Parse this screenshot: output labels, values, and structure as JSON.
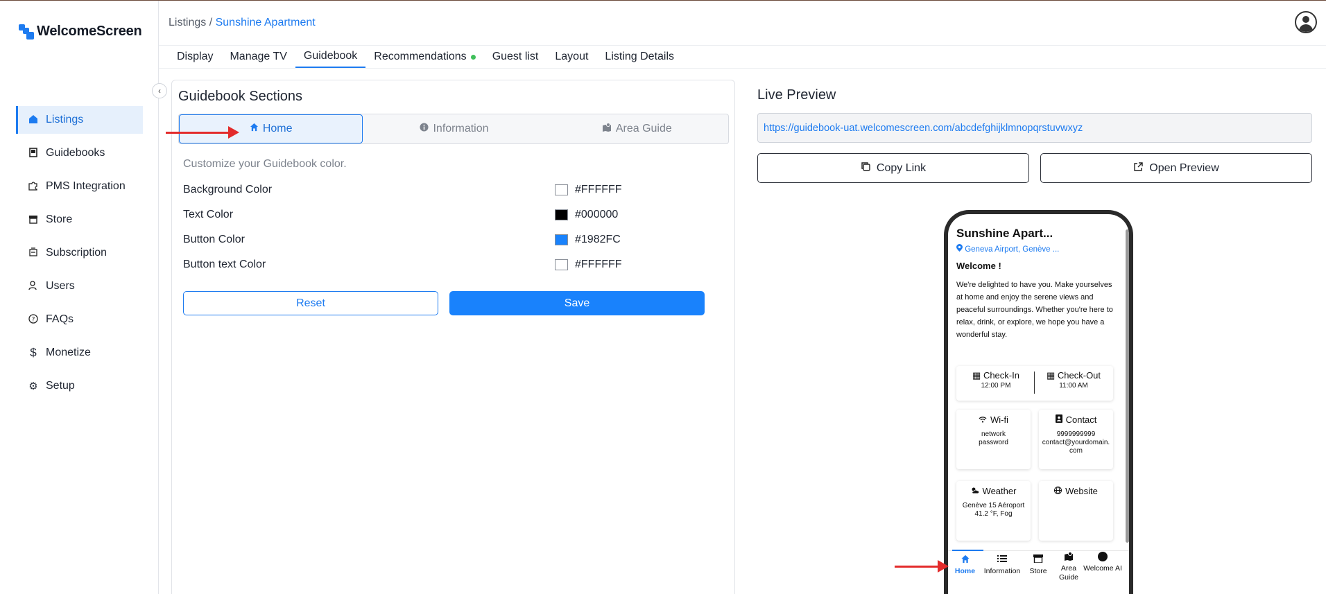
{
  "brand": {
    "name": "WelcomeScreen"
  },
  "sidebar": {
    "items": [
      {
        "label": "Listings",
        "icon": "home-icon",
        "active": true
      },
      {
        "label": "Guidebooks",
        "icon": "book-icon"
      },
      {
        "label": "PMS Integration",
        "icon": "puzzle-icon"
      },
      {
        "label": "Store",
        "icon": "store-icon"
      },
      {
        "label": "Subscription",
        "icon": "subscription-icon"
      },
      {
        "label": "Users",
        "icon": "user-icon"
      },
      {
        "label": "FAQs",
        "icon": "question-icon"
      },
      {
        "label": "Monetize",
        "icon": "dollar-icon"
      },
      {
        "label": "Setup",
        "icon": "gear-icon"
      }
    ]
  },
  "header": {
    "breadcrumb_root": "Listings",
    "breadcrumb_sep": " / ",
    "breadcrumb_current": "Sunshine Apartment"
  },
  "tabs": [
    {
      "label": "Display"
    },
    {
      "label": "Manage TV"
    },
    {
      "label": "Guidebook",
      "active": true
    },
    {
      "label": "Recommendations",
      "status_dot": "#3fbf5a"
    },
    {
      "label": "Guest list"
    },
    {
      "label": "Layout"
    },
    {
      "label": "Listing Details"
    }
  ],
  "guidebook": {
    "title": "Guidebook Sections",
    "sections": [
      {
        "label": "Home",
        "icon": "home-icon",
        "active": true
      },
      {
        "label": "Information",
        "icon": "info-icon"
      },
      {
        "label": "Area Guide",
        "icon": "map-icon"
      }
    ],
    "customize_text": "Customize your Guidebook color.",
    "colors": [
      {
        "label": "Background Color",
        "value": "#FFFFFF"
      },
      {
        "label": "Text Color",
        "value": "#000000"
      },
      {
        "label": "Button Color",
        "value": "#1982FC"
      },
      {
        "label": "Button text Color",
        "value": "#FFFFFF"
      }
    ],
    "reset_label": "Reset",
    "save_label": "Save"
  },
  "live_preview": {
    "title": "Live Preview",
    "url": "https://guidebook-uat.welcomescreen.com/abcdefghijklmnopqrstuvwxyz",
    "copy_label": "Copy Link",
    "open_label": "Open Preview"
  },
  "phone": {
    "title": "Sunshine Apart...",
    "location": "Geneva Airport, Genève ...",
    "welcome": "Welcome !",
    "message": "We're delighted to have you. Make yourselves at home and enjoy the serene views and peaceful surroundings. Whether you're here to relax, drink, or explore, we hope you have a wonderful stay.",
    "checkin_label": "Check-In",
    "checkin_time": "12:00 PM",
    "checkout_label": "Check-Out",
    "checkout_time": "11:00 AM",
    "wifi_label": "Wi-fi",
    "wifi_network": "network",
    "wifi_password": "password",
    "contact_label": "Contact",
    "contact_phone": "9999999999",
    "contact_email": "contact@yourdomain.com",
    "weather_label": "Weather",
    "weather_place": "Genève 15 Aéroport",
    "weather_value": "41.2 °F, Fog",
    "website_label": "Website",
    "tabbar": [
      {
        "label": "Home",
        "active": true
      },
      {
        "label": "Information"
      },
      {
        "label": "Store"
      },
      {
        "label": "Area Guide"
      },
      {
        "label": "Welcome AI"
      }
    ]
  }
}
